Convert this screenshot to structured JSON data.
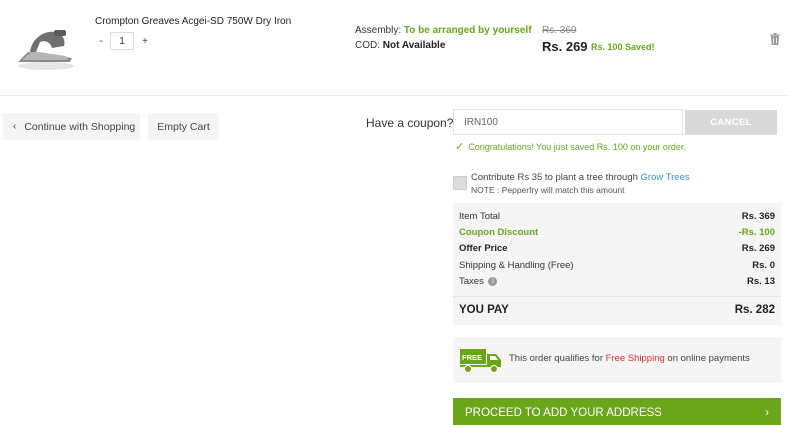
{
  "item": {
    "name": "Crompton Greaves Acgei-SD 750W Dry Iron",
    "qty_minus": "-",
    "qty": "1",
    "qty_plus": "+",
    "assembly_label": "Assembly:",
    "assembly_value": "To be arranged by yourself",
    "cod_label": "COD:",
    "cod_value": "Not Available",
    "price_old": "Rs. 369",
    "price_new": "Rs. 269",
    "price_saved": "Rs. 100 Saved!"
  },
  "actions": {
    "continue_label": "Continue with Shopping",
    "empty_label": "Empty Cart"
  },
  "coupon": {
    "label": "Have a coupon?",
    "value": "IRN100",
    "cancel_label": "CANCEL",
    "message": "Congratulations! You just saved Rs. 100 on your order."
  },
  "contribute": {
    "text": "Contribute Rs 35 to plant a tree through",
    "link": "Grow Trees",
    "note": "NOTE : Pepperfry will match this amount"
  },
  "summary": {
    "rows": [
      {
        "label": "Item Total",
        "value": "Rs. 369"
      },
      {
        "label": "Coupon Discount",
        "value": "-Rs. 100"
      },
      {
        "label": "Offer Price",
        "value": "Rs. 269"
      },
      {
        "label": "Shipping & Handling (Free)",
        "value": "Rs. 0"
      },
      {
        "label": "Taxes",
        "value": "Rs. 13"
      }
    ],
    "you_pay_label": "YOU PAY",
    "you_pay_value": "Rs. 282"
  },
  "shipping": {
    "badge": "FREE",
    "text_pre": "This order qualifies for",
    "text_highlight": "Free Shipping",
    "text_post": "on online payments"
  },
  "proceed": {
    "label": "PROCEED TO ADD YOUR ADDRESS",
    "arrow": "›"
  },
  "colors": {
    "green": "#6aa51a",
    "link_blue": "#3a8fc9",
    "red": "#e0302a",
    "cancel_gray": "#d9d9d9"
  }
}
